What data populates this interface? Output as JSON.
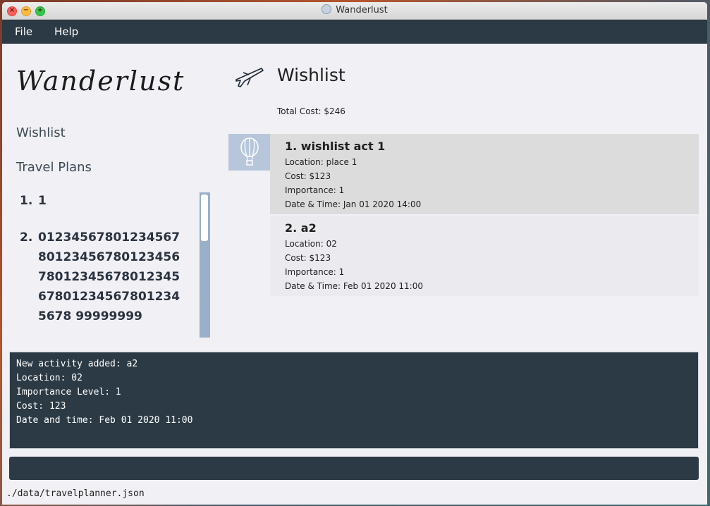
{
  "window": {
    "title": "Wanderlust"
  },
  "menu": {
    "items": [
      "File",
      "Help"
    ]
  },
  "sidebar": {
    "logo": "Wanderlust",
    "nav": [
      {
        "label": "Wishlist"
      },
      {
        "label": "Travel Plans"
      }
    ],
    "plans": [
      {
        "index": "1.",
        "name": "1"
      },
      {
        "index": "2.",
        "name": "012345678012345678012345678012345678012345678012345678012345678012345678 99999999"
      }
    ]
  },
  "main": {
    "title": "Wishlist",
    "total_cost": "Total Cost: $246",
    "activities": [
      {
        "title": "1.  wishlist act 1",
        "location": "Location: place 1",
        "cost": "Cost: $123",
        "importance": "Importance: 1",
        "datetime": "Date & Time: Jan 01 2020 14:00"
      },
      {
        "title": "2.  a2",
        "location": "Location: 02",
        "cost": "Cost: $123",
        "importance": "Importance: 1",
        "datetime": "Date & Time: Feb 01 2020 11:00"
      }
    ]
  },
  "result": {
    "lines": [
      "New activity added: a2",
      "Location: 02",
      "Importance Level: 1",
      "Cost: 123",
      "Date and time: Feb 01 2020 11:00"
    ]
  },
  "command": {
    "value": ""
  },
  "status": {
    "path": "./data/travelplanner.json"
  },
  "colors": {
    "menubar": "#2b3a44",
    "accent": "#9aafc8",
    "selected": "#dcdcdc"
  }
}
